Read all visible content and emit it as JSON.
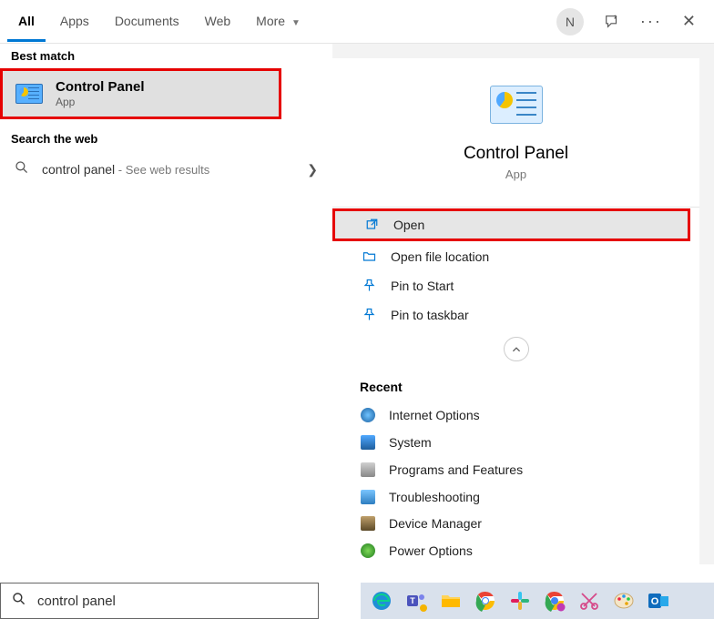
{
  "header": {
    "tabs": [
      "All",
      "Apps",
      "Documents",
      "Web",
      "More"
    ],
    "activeTabIndex": 0,
    "userInitial": "N"
  },
  "left": {
    "bestMatchHeader": "Best match",
    "bestMatch": {
      "title": "Control Panel",
      "subtitle": "App"
    },
    "searchWebHeader": "Search the web",
    "webQuery": "control panel",
    "webSuffix": " - See web results"
  },
  "right": {
    "title": "Control Panel",
    "subtitle": "App",
    "actions": [
      "Open",
      "Open file location",
      "Pin to Start",
      "Pin to taskbar"
    ],
    "recentHeader": "Recent",
    "recent": [
      "Internet Options",
      "System",
      "Programs and Features",
      "Troubleshooting",
      "Device Manager",
      "Power Options"
    ]
  },
  "search": {
    "value": "control panel"
  }
}
